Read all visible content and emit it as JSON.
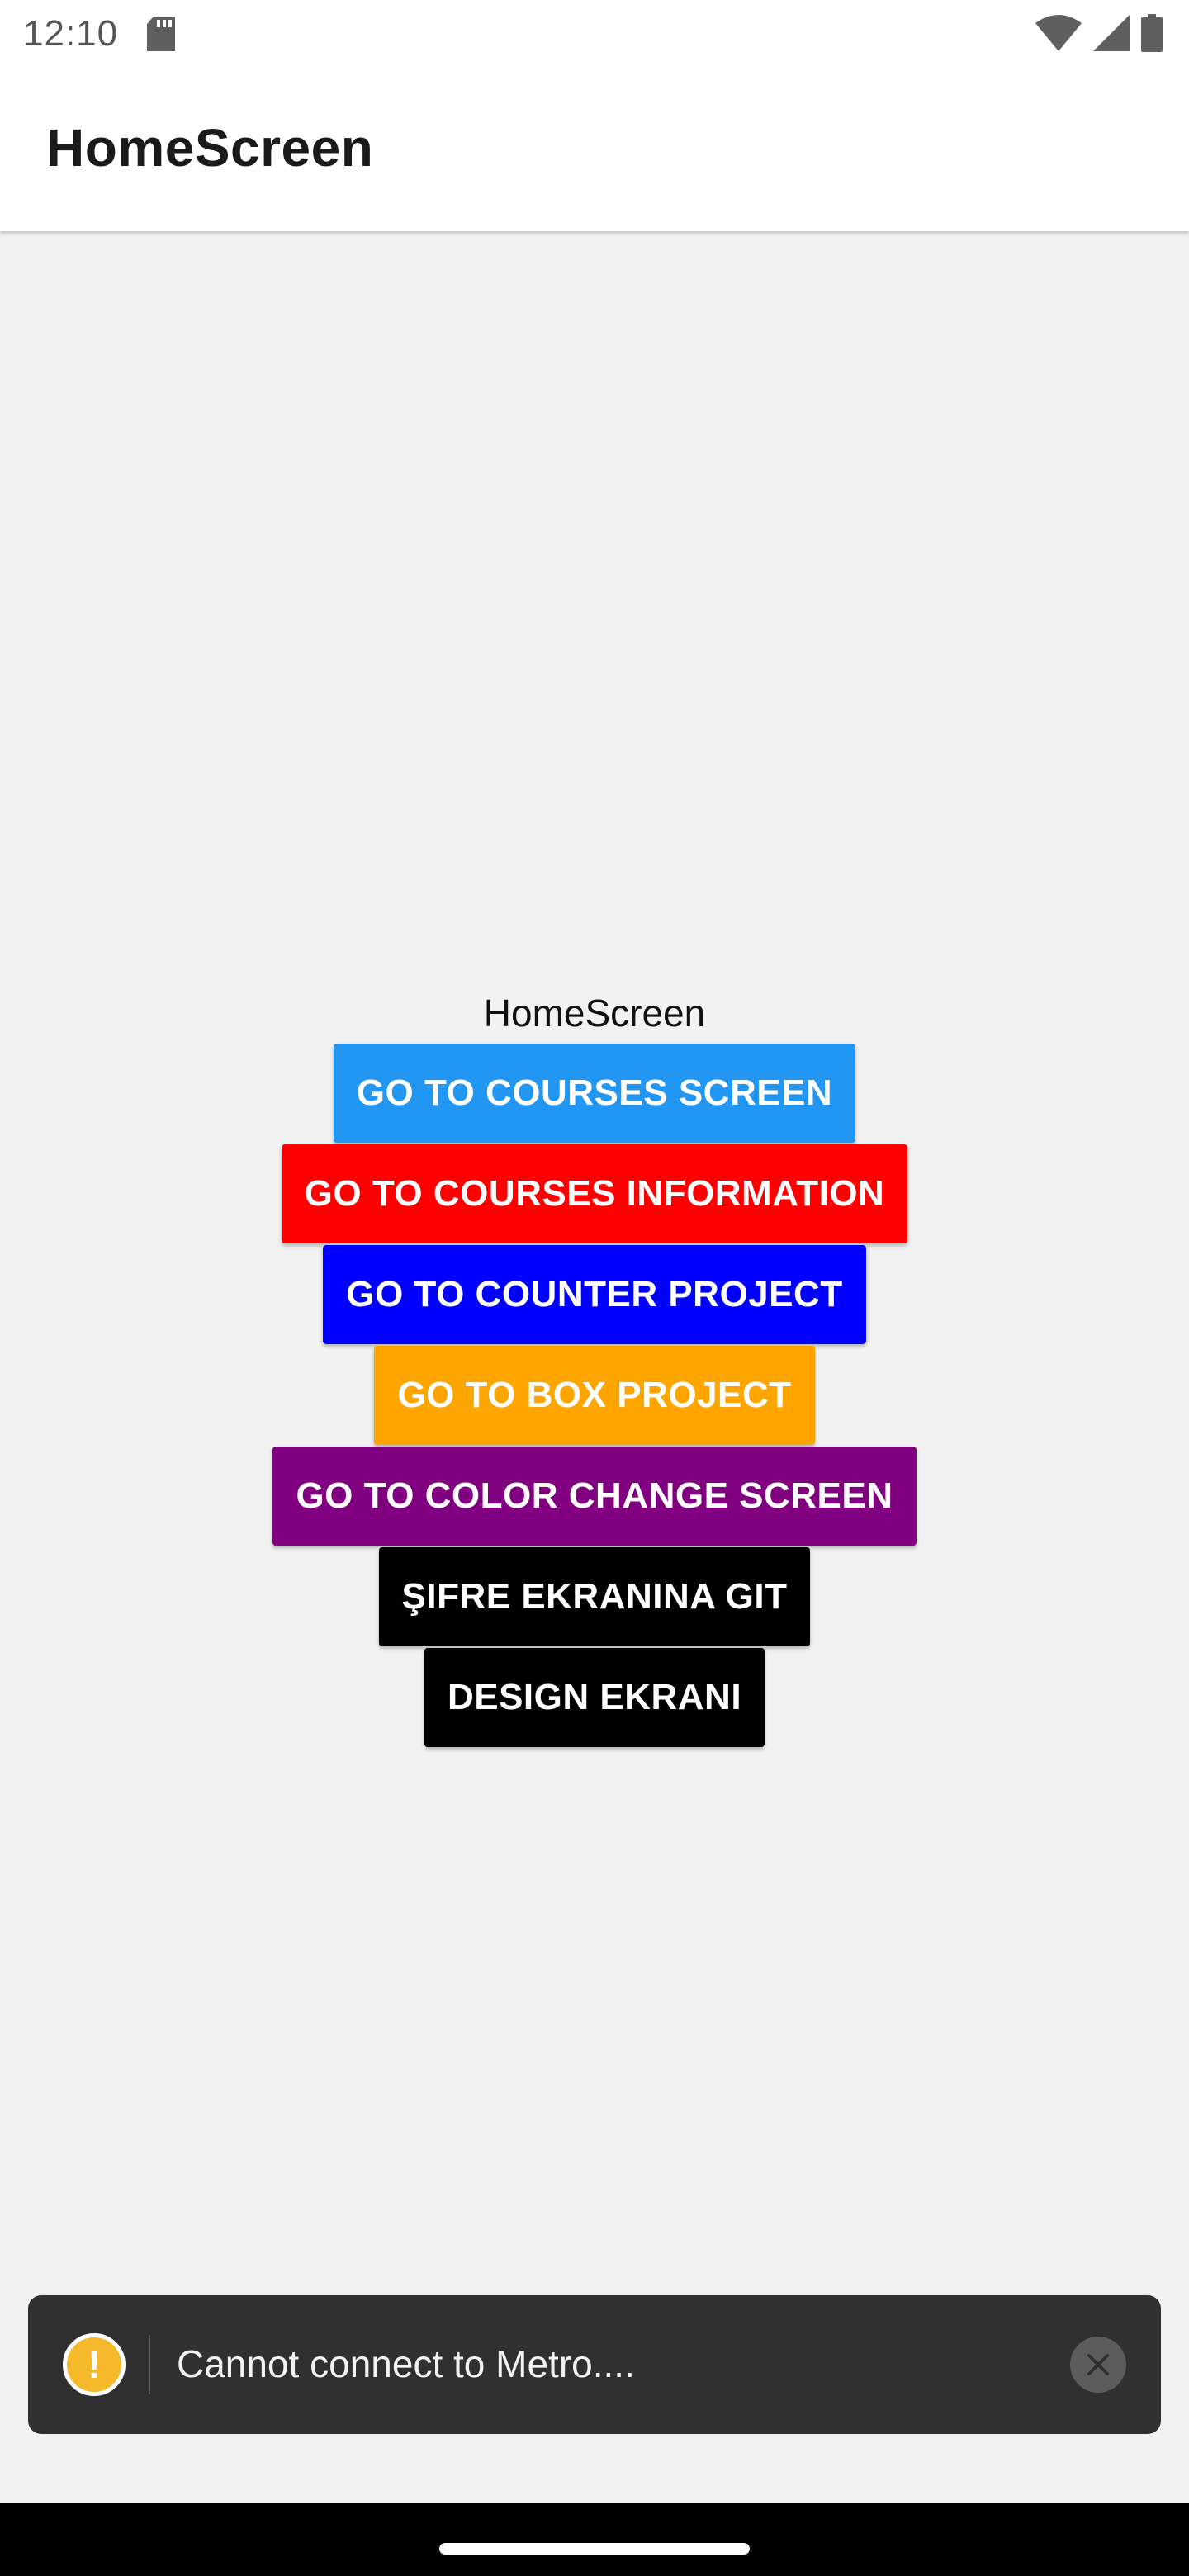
{
  "status_bar": {
    "time": "12:10",
    "icons": [
      "sd-card-icon",
      "wifi-icon",
      "signal-icon",
      "battery-icon"
    ]
  },
  "app_bar": {
    "title": "HomeScreen"
  },
  "main": {
    "label": "HomeScreen",
    "buttons": [
      {
        "label": "GO TO COURSES SCREEN",
        "color": "#2196F3"
      },
      {
        "label": "GO TO COURSES INFORMATION",
        "color": "#FF0000"
      },
      {
        "label": "GO TO COUNTER PROJECT",
        "color": "#0000FF"
      },
      {
        "label": "GO TO BOX PROJECT",
        "color": "#FFA500"
      },
      {
        "label": "GO TO COLOR CHANGE SCREEN",
        "color": "#800080"
      },
      {
        "label": "ŞIFRE EKRANINA GIT",
        "color": "#000000"
      },
      {
        "label": "DESIGN EKRANI",
        "color": "#000000"
      }
    ]
  },
  "toast": {
    "message": "Cannot connect to Metro....",
    "icon": "warning-icon",
    "icon_color": "#F5B92B"
  }
}
